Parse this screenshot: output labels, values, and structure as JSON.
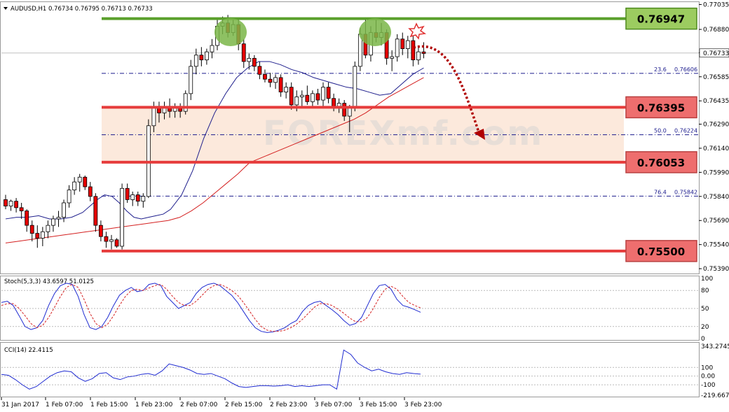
{
  "header": {
    "symbol_line": "AUDUSD,H1  0.76734 0.76795 0.76713 0.76733"
  },
  "watermark": "FOREXmf.com",
  "current_price_label": "0.76733",
  "colors": {
    "bull": "#000000",
    "bear_fill": "#e60000",
    "resistance": "#5aa02c",
    "support": "#e63c3c",
    "zone": "#fbe3d3",
    "ma_fast": "#1e1e8c",
    "ma_slow": "#d42020",
    "fib": "#1a1a8c",
    "arrow": "#b00000",
    "stoch_main": "#1f2bd1",
    "stoch_signal": "#d42020",
    "cci": "#1f2bd1"
  },
  "chart_data": [
    {
      "type": "candlestick",
      "title": "AUDUSD,H1",
      "ylim": [
        0.7536,
        0.7705
      ],
      "y_ticks": [
        "0.77035",
        "0.76880",
        "0.76735",
        "0.76585",
        "0.76435",
        "0.76290",
        "0.76140",
        "0.75990",
        "0.75840",
        "0.75690",
        "0.75540",
        "0.75390"
      ],
      "x_ticks": [
        "31 Jan 2017",
        "1 Feb 07:00",
        "1 Feb 15:00",
        "1 Feb 23:00",
        "2 Feb 07:00",
        "2 Feb 15:00",
        "2 Feb 23:00",
        "3 Feb 07:00",
        "3 Feb 15:00",
        "3 Feb 23:00"
      ],
      "levels": [
        {
          "label": "0.76947",
          "value": 0.76947,
          "kind": "resistance"
        },
        {
          "label": "0.76395",
          "value": 0.76395,
          "kind": "support"
        },
        {
          "label": "0.76053",
          "value": 0.76053,
          "kind": "support"
        },
        {
          "label": "0.75500",
          "value": 0.755,
          "kind": "support"
        }
      ],
      "zone": [
        0.76053,
        0.76395
      ],
      "fibonacci": [
        {
          "ratio": "23.6",
          "value": "0.76606",
          "price": 0.76606
        },
        {
          "ratio": "50.0",
          "value": "0.76224",
          "price": 0.76224
        },
        {
          "ratio": "76.4",
          "value": "0.75842",
          "price": 0.75842
        }
      ],
      "ohlc": [
        [
          0.7582,
          0.7585,
          0.7576,
          0.7578
        ],
        [
          0.7578,
          0.7582,
          0.7575,
          0.7581
        ],
        [
          0.7581,
          0.7583,
          0.7574,
          0.7577
        ],
        [
          0.7577,
          0.758,
          0.757,
          0.7575
        ],
        [
          0.7575,
          0.7576,
          0.7562,
          0.7566
        ],
        [
          0.7566,
          0.7569,
          0.7556,
          0.7561
        ],
        [
          0.7561,
          0.7566,
          0.7552,
          0.7558
        ],
        [
          0.7558,
          0.7565,
          0.7553,
          0.7562
        ],
        [
          0.7562,
          0.7569,
          0.7558,
          0.7566
        ],
        [
          0.7566,
          0.7572,
          0.7562,
          0.757
        ],
        [
          0.757,
          0.7575,
          0.7565,
          0.7571
        ],
        [
          0.7571,
          0.7582,
          0.7568,
          0.758
        ],
        [
          0.758,
          0.7591,
          0.7577,
          0.7588
        ],
        [
          0.7588,
          0.7596,
          0.7585,
          0.7593
        ],
        [
          0.7593,
          0.7598,
          0.7587,
          0.7596
        ],
        [
          0.7596,
          0.7597,
          0.7588,
          0.759
        ],
        [
          0.759,
          0.7593,
          0.7581,
          0.7584
        ],
        [
          0.7584,
          0.7586,
          0.7562,
          0.7566
        ],
        [
          0.7566,
          0.7569,
          0.7556,
          0.7559
        ],
        [
          0.7559,
          0.7562,
          0.7552,
          0.7556
        ],
        [
          0.7556,
          0.756,
          0.7551,
          0.7557
        ],
        [
          0.7557,
          0.7558,
          0.7552,
          0.7553
        ],
        [
          0.7553,
          0.7592,
          0.7551,
          0.7589
        ],
        [
          0.7589,
          0.7592,
          0.758,
          0.7582
        ],
        [
          0.7582,
          0.7587,
          0.7578,
          0.7585
        ],
        [
          0.7585,
          0.7587,
          0.7578,
          0.7581
        ],
        [
          0.7581,
          0.7586,
          0.7577,
          0.7584
        ],
        [
          0.7584,
          0.7632,
          0.7583,
          0.7628
        ],
        [
          0.7628,
          0.7643,
          0.7624,
          0.764
        ],
        [
          0.764,
          0.7643,
          0.763,
          0.7636
        ],
        [
          0.7636,
          0.7643,
          0.7632,
          0.764
        ],
        [
          0.764,
          0.7645,
          0.7633,
          0.7637
        ],
        [
          0.7637,
          0.7642,
          0.7633,
          0.7639
        ],
        [
          0.7639,
          0.7642,
          0.7633,
          0.7637
        ],
        [
          0.7637,
          0.765,
          0.7635,
          0.7648
        ],
        [
          0.7648,
          0.7669,
          0.7644,
          0.7665
        ],
        [
          0.7665,
          0.7676,
          0.766,
          0.7672
        ],
        [
          0.7672,
          0.7677,
          0.7665,
          0.7669
        ],
        [
          0.7669,
          0.7676,
          0.7666,
          0.7674
        ],
        [
          0.7674,
          0.7682,
          0.767,
          0.7678
        ],
        [
          0.7678,
          0.7695,
          0.7675,
          0.769
        ],
        [
          0.769,
          0.7696,
          0.7685,
          0.7692
        ],
        [
          0.7692,
          0.7697,
          0.7683,
          0.7686
        ],
        [
          0.7686,
          0.7694,
          0.7684,
          0.7691
        ],
        [
          0.7691,
          0.7695,
          0.7675,
          0.7679
        ],
        [
          0.7679,
          0.7682,
          0.7664,
          0.7668
        ],
        [
          0.7668,
          0.7673,
          0.7663,
          0.767
        ],
        [
          0.767,
          0.7672,
          0.7662,
          0.7665
        ],
        [
          0.7665,
          0.7668,
          0.7657,
          0.766
        ],
        [
          0.766,
          0.7663,
          0.7655,
          0.7657
        ],
        [
          0.7657,
          0.7661,
          0.7652,
          0.7655
        ],
        [
          0.7655,
          0.766,
          0.7651,
          0.7658
        ],
        [
          0.7658,
          0.766,
          0.7646,
          0.7649
        ],
        [
          0.7649,
          0.7655,
          0.7645,
          0.7652
        ],
        [
          0.7652,
          0.7655,
          0.7638,
          0.7641
        ],
        [
          0.7641,
          0.765,
          0.7637,
          0.7646
        ],
        [
          0.7646,
          0.765,
          0.764,
          0.7647
        ],
        [
          0.7647,
          0.7653,
          0.7641,
          0.7643
        ],
        [
          0.7643,
          0.765,
          0.764,
          0.7648
        ],
        [
          0.7648,
          0.7651,
          0.7641,
          0.7644
        ],
        [
          0.7644,
          0.7655,
          0.764,
          0.7652
        ],
        [
          0.7652,
          0.7655,
          0.7642,
          0.7645
        ],
        [
          0.7645,
          0.7648,
          0.7637,
          0.764
        ],
        [
          0.764,
          0.7645,
          0.7636,
          0.7642
        ],
        [
          0.7642,
          0.7644,
          0.7631,
          0.7634
        ],
        [
          0.7634,
          0.7641,
          0.7624,
          0.7639
        ],
        [
          0.7639,
          0.7668,
          0.7637,
          0.7665
        ],
        [
          0.7665,
          0.7689,
          0.7662,
          0.7685
        ],
        [
          0.7685,
          0.7695,
          0.767,
          0.7672
        ],
        [
          0.7672,
          0.769,
          0.7668,
          0.7686
        ],
        [
          0.7686,
          0.7694,
          0.768,
          0.7683
        ],
        [
          0.7683,
          0.7692,
          0.7678,
          0.7686
        ],
        [
          0.7686,
          0.7688,
          0.7666,
          0.767
        ],
        [
          0.767,
          0.7675,
          0.7662,
          0.7671
        ],
        [
          0.7671,
          0.7685,
          0.7668,
          0.7682
        ],
        [
          0.7682,
          0.7686,
          0.7672,
          0.7676
        ],
        [
          0.7676,
          0.7684,
          0.767,
          0.7681
        ],
        [
          0.7681,
          0.7684,
          0.7665,
          0.7669
        ],
        [
          0.7669,
          0.7677,
          0.7666,
          0.7674
        ],
        [
          0.7674,
          0.768,
          0.767,
          0.7673
        ]
      ],
      "ma_fast": [
        0.757,
        0.7571,
        0.7571,
        0.7572,
        0.757,
        0.757,
        0.7571,
        0.7574,
        0.7578,
        0.7582,
        0.7585,
        0.7584,
        0.758,
        0.7575,
        0.7571,
        0.757,
        0.7571,
        0.7572,
        0.7573,
        0.7576,
        0.7585,
        0.76,
        0.762,
        0.7636,
        0.7648,
        0.7658,
        0.7664,
        0.7668,
        0.7668,
        0.7666,
        0.7663,
        0.7661,
        0.7658,
        0.7656,
        0.7654,
        0.7652,
        0.7651,
        0.7649,
        0.7647,
        0.7648,
        0.7654,
        0.766,
        0.7664
      ],
      "ma_fast_idx": [
        0,
        3,
        6,
        9,
        12,
        15,
        18,
        21,
        23,
        25,
        27,
        29,
        31,
        33,
        35,
        37,
        39,
        41,
        43,
        45,
        48,
        51,
        54,
        57,
        60,
        63,
        66,
        69,
        72,
        75,
        78,
        81,
        84,
        87,
        90,
        93,
        96,
        99,
        102,
        105,
        108,
        111,
        114
      ],
      "ma_slow": [
        0.7555,
        0.7556,
        0.7557,
        0.7558,
        0.7559,
        0.756,
        0.7561,
        0.7562,
        0.7563,
        0.7564,
        0.7565,
        0.7566,
        0.7567,
        0.7568,
        0.7569,
        0.7571,
        0.7575,
        0.758,
        0.7586,
        0.7592,
        0.7598,
        0.7605,
        0.7608,
        0.7611,
        0.7614,
        0.7617,
        0.762,
        0.7623,
        0.7626,
        0.7629,
        0.7632,
        0.7636,
        0.7641,
        0.7646,
        0.765,
        0.7654,
        0.7658
      ],
      "ma_slow_idx": [
        0,
        4,
        8,
        12,
        16,
        20,
        24,
        28,
        32,
        36,
        40,
        44,
        48,
        52,
        56,
        60,
        64,
        68,
        72,
        76,
        80,
        84,
        88,
        92,
        96,
        100,
        104,
        108,
        112,
        116,
        120,
        124,
        128,
        132,
        136,
        140,
        144
      ]
    },
    {
      "type": "line",
      "title": "Stoch(5,3,3) 43.6597 51.0125",
      "ylim": [
        0,
        100
      ],
      "y_ticks": [
        "100",
        "80",
        "50",
        "20",
        "0"
      ],
      "series": [
        {
          "name": "main",
          "values": [
            60,
            62,
            55,
            38,
            20,
            15,
            18,
            30,
            55,
            75,
            88,
            92,
            90,
            70,
            40,
            18,
            15,
            20,
            35,
            55,
            72,
            80,
            85,
            78,
            80,
            90,
            92,
            88,
            70,
            60,
            50,
            55,
            60,
            75,
            85,
            90,
            92,
            88,
            80,
            72,
            60,
            45,
            30,
            18,
            12,
            10,
            11,
            14,
            18,
            25,
            30,
            45,
            55,
            60,
            62,
            55,
            48,
            40,
            30,
            22,
            25,
            35,
            55,
            75,
            88,
            90,
            82,
            65,
            55,
            52,
            48,
            43.6597
          ]
        },
        {
          "name": "signal",
          "values": [
            55,
            58,
            58,
            50,
            38,
            25,
            18,
            22,
            35,
            52,
            70,
            85,
            90,
            85,
            65,
            42,
            25,
            18,
            24,
            38,
            55,
            70,
            80,
            82,
            80,
            84,
            88,
            90,
            82,
            70,
            60,
            55,
            55,
            62,
            72,
            82,
            88,
            90,
            86,
            80,
            72,
            60,
            46,
            32,
            20,
            14,
            12,
            12,
            14,
            18,
            24,
            32,
            42,
            52,
            58,
            58,
            55,
            49,
            42,
            34,
            28,
            28,
            35,
            50,
            68,
            82,
            87,
            82,
            70,
            60,
            55,
            51.0125
          ]
        }
      ]
    },
    {
      "type": "line",
      "title": "CCI(14) 22.4115",
      "y_ticks": [
        "343.2745",
        "100",
        "0.00",
        "-100",
        "-219.6674"
      ],
      "ylim": [
        -219.6674,
        343.2745
      ],
      "series": [
        {
          "name": "CCI",
          "values": [
            20,
            10,
            -40,
            -100,
            -150,
            -120,
            -60,
            0,
            40,
            60,
            50,
            -20,
            -60,
            -30,
            30,
            40,
            -20,
            -40,
            -10,
            0,
            20,
            30,
            10,
            60,
            140,
            120,
            100,
            70,
            30,
            20,
            30,
            0,
            -30,
            -80,
            -120,
            -130,
            -120,
            -110,
            -110,
            -115,
            -110,
            -100,
            -120,
            -110,
            -120,
            -110,
            -100,
            -100,
            -150,
            300,
            250,
            150,
            100,
            60,
            80,
            50,
            30,
            20,
            40,
            30,
            22.4115
          ]
        }
      ]
    }
  ]
}
